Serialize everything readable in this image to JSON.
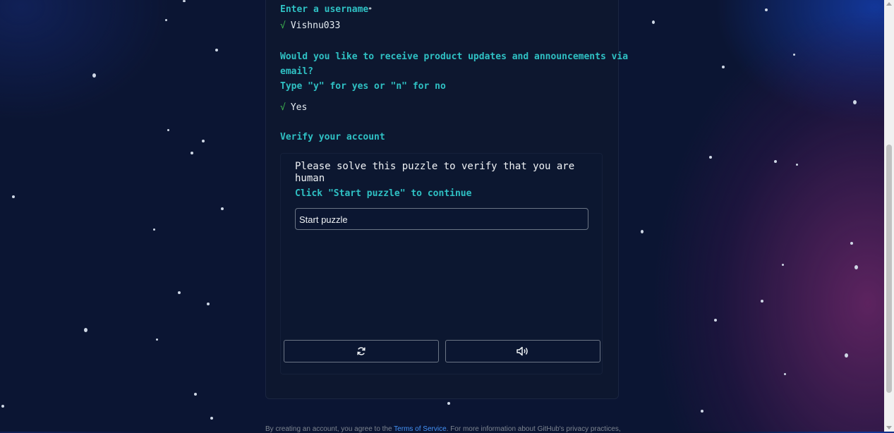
{
  "form": {
    "username_label": "Enter a username",
    "username_required_mark": "*",
    "username_value": "Vishnu033",
    "email_prompt_line1": "Would you like to receive product updates and announcements via",
    "email_prompt_line2": "email?",
    "email_prompt_hint": "Type \"y\" for yes or \"n\" for no",
    "email_value": "Yes",
    "verify_label": "Verify your account",
    "check_glyph": "√"
  },
  "puzzle": {
    "title": "Please solve this puzzle to verify that you are human",
    "subtitle": "Click \"Start puzzle\" to continue",
    "start_button": "Start puzzle",
    "refresh_icon": "refresh-icon",
    "audio_icon": "audio-icon"
  },
  "footer": {
    "text_before": "By creating an account, you agree to the ",
    "terms_link": "Terms of Service",
    "text_after": ". For more information about GitHub's privacy practices,"
  },
  "colors": {
    "accent": "#2fc1c4",
    "check": "#3fb950",
    "background": "#0b1533",
    "link": "#4493f8"
  }
}
